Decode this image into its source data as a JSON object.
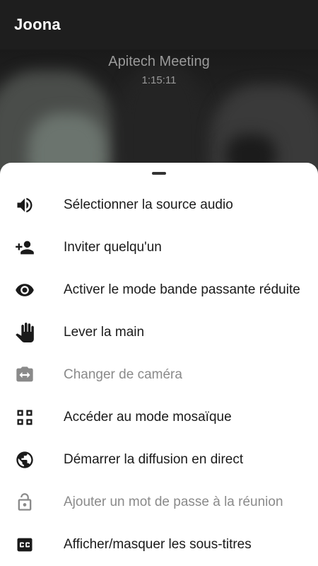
{
  "appbar": {
    "title": "Joona"
  },
  "meeting": {
    "title": "Apitech Meeting",
    "duration": "1:15:11"
  },
  "menu": {
    "items": [
      {
        "label": "Sélectionner la source audio",
        "icon": "speaker-icon",
        "enabled": true
      },
      {
        "label": "Inviter quelqu'un",
        "icon": "add-person-icon",
        "enabled": true
      },
      {
        "label": "Activer le mode bande passante réduite",
        "icon": "eye-icon",
        "enabled": true
      },
      {
        "label": "Lever la main",
        "icon": "hand-icon",
        "enabled": true
      },
      {
        "label": "Changer de caméra",
        "icon": "switch-camera-icon",
        "enabled": false
      },
      {
        "label": "Accéder au mode mosaïque",
        "icon": "tile-grid-icon",
        "enabled": true
      },
      {
        "label": "Démarrer la diffusion en direct",
        "icon": "globe-icon",
        "enabled": true
      },
      {
        "label": "Ajouter un mot de passe à la réunion",
        "icon": "lock-icon",
        "enabled": false
      },
      {
        "label": "Afficher/masquer les sous-titres",
        "icon": "closed-captions-icon",
        "enabled": true
      }
    ]
  },
  "colors": {
    "appbar": "#1e1e1e",
    "sheet": "#ffffff",
    "text": "#1a1a1a",
    "disabled": "#8a8a8a"
  }
}
